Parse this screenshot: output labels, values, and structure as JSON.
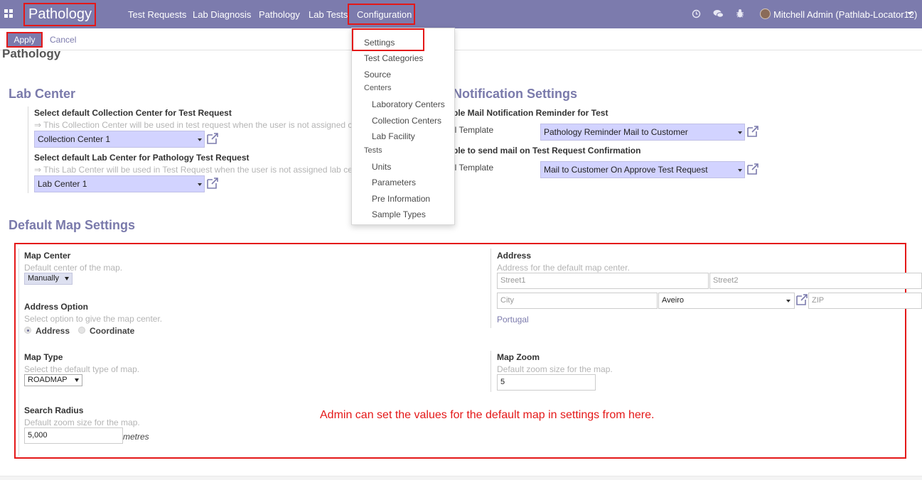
{
  "navbar": {
    "brand": "Pathology",
    "menu": [
      "Test Requests",
      "Lab Diagnosis",
      "Pathology",
      "Lab Tests",
      "Configuration"
    ],
    "user": "Mitchell Admin (Pathlab-Locator12)",
    "bg_color": "#7c7bad"
  },
  "control_panel": {
    "apply_label": "Apply",
    "cancel_label": "Cancel",
    "title": "Pathology"
  },
  "dropdown": {
    "settings": "Settings",
    "test_categories": "Test Categories",
    "source": "Source",
    "centers_header": "Centers",
    "laboratory_centers": "Laboratory Centers",
    "collection_centers": "Collection Centers",
    "lab_facility": "Lab Facility",
    "tests_header": "Tests",
    "units": "Units",
    "parameters": "Parameters",
    "pre_information": "Pre Information",
    "sample_types": "Sample Types"
  },
  "lab_center": {
    "title": "Lab Center",
    "collection_label": "Select default Collection Center for Test Request",
    "collection_hint": "⇒ This Collection Center will be used in test request when the user is not assigned col",
    "collection_value": "Collection Center 1",
    "lab_label": "Select default Lab Center for Pathology Test Request",
    "lab_hint": "⇒ This Lab Center will be used in Test Request when the user is not assigned lab cent",
    "lab_value": "Lab Center 1"
  },
  "notification": {
    "title": "Notification Settings",
    "reminder_label": "ble Mail Notification Reminder for Test",
    "reminder_field": "il Template",
    "reminder_value": "Pathology Reminder Mail to Customer",
    "confirm_label": "ble to send mail on Test Request Confirmation",
    "confirm_field": "il Template",
    "confirm_value": "Mail to Customer On Approve Test Request"
  },
  "map_settings": {
    "title": "Default Map Settings",
    "map_center_label": "Map Center",
    "map_center_hint": "Default center of the map.",
    "map_center_value": "Manually",
    "address_option_label": "Address Option",
    "address_option_hint": "Select option to give the map center.",
    "address_radio": "Address",
    "coordinate_radio": "Coordinate",
    "map_type_label": "Map Type",
    "map_type_hint": "Select the default type of map.",
    "map_type_value": "ROADMAP",
    "search_radius_label": "Search Radius",
    "search_radius_hint": "Default zoom size for the map.",
    "search_radius_value": "5,000",
    "search_radius_unit": "metres",
    "address_label": "Address",
    "address_hint": "Address for the default map center.",
    "street1_placeholder": "Street1",
    "street2_placeholder": "Street2",
    "city_placeholder": "City",
    "state_value": "Aveiro",
    "zip_placeholder": "ZIP",
    "country": "Portugal",
    "map_zoom_label": "Map Zoom",
    "map_zoom_hint": "Default zoom size for the map.",
    "map_zoom_value": "5"
  },
  "annotation": "Admin can set the values for the default map in settings from here."
}
